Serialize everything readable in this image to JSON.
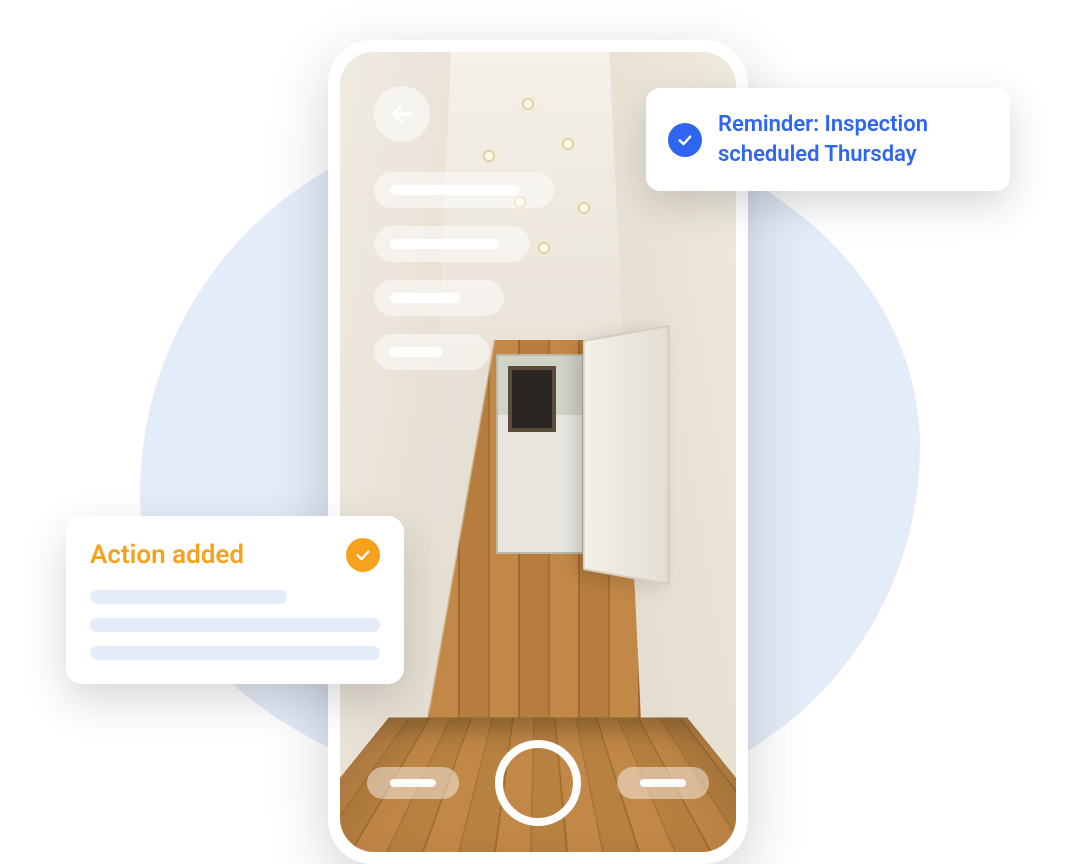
{
  "colors": {
    "accent_blue": "#2f66f1",
    "accent_orange": "#f6a21d",
    "blob_bg": "#e4ebf9"
  },
  "reminder": {
    "text": "Reminder: Inspection scheduled Thursday",
    "icon": "check-icon"
  },
  "action_card": {
    "title": "Action added",
    "icon": "check-icon",
    "placeholder_lines": 3
  },
  "phone": {
    "back_icon": "arrow-left-icon",
    "overlay_pills": 4,
    "bottom_pills": 2,
    "shutter": true
  }
}
